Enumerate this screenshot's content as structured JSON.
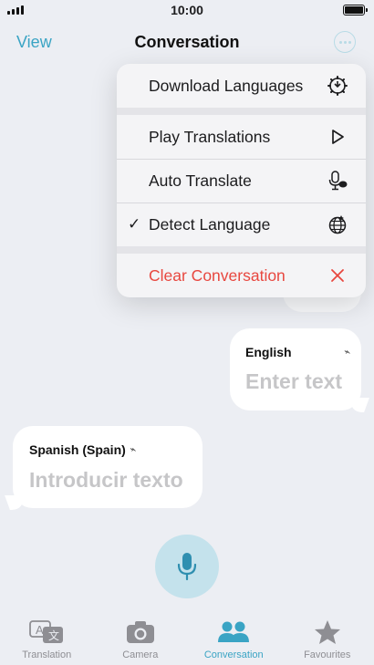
{
  "status_bar": {
    "time": "10:00"
  },
  "nav": {
    "left_label": "View",
    "title": "Conversation",
    "more_icon": "ellipsis-circle-icon"
  },
  "menu": {
    "items": [
      {
        "label": "Download Languages",
        "icon": "download-gear-icon",
        "checked": false
      },
      {
        "label": "Play Translations",
        "icon": "play-icon",
        "checked": false
      },
      {
        "label": "Auto Translate",
        "icon": "mic-auto-icon",
        "checked": false
      },
      {
        "label": "Detect Language",
        "icon": "globe-detect-icon",
        "checked": true,
        "check_mark": "✓"
      },
      {
        "label": "Clear Conversation",
        "icon": "close-icon",
        "checked": false,
        "destructive": true
      }
    ]
  },
  "conversation": {
    "english": {
      "language": "English",
      "placeholder": "Enter text"
    },
    "spanish": {
      "language": "Spanish (Spain)",
      "placeholder": "Introducir texto"
    }
  },
  "tabbar": {
    "tabs": [
      {
        "label": "Translation",
        "icon": "translate-icon",
        "active": false
      },
      {
        "label": "Camera",
        "icon": "camera-icon",
        "active": false
      },
      {
        "label": "Conversation",
        "icon": "people-icon",
        "active": true
      },
      {
        "label": "Favourites",
        "icon": "star-icon",
        "active": false
      }
    ]
  },
  "colors": {
    "accent": "#3aa4c4",
    "destructive": "#e8473f",
    "background": "#eceef3"
  }
}
